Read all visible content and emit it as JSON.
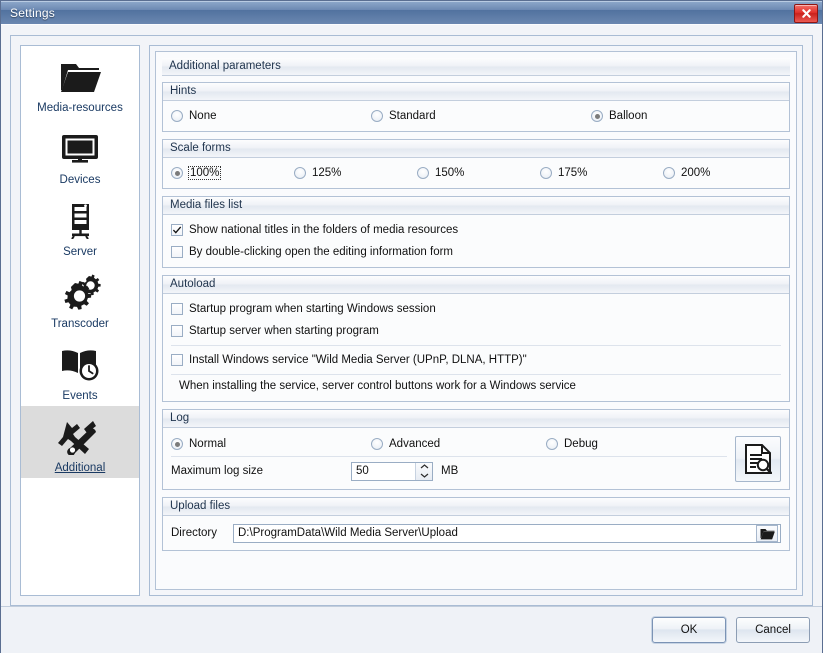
{
  "window": {
    "title": "Settings",
    "close_icon": "close-icon"
  },
  "sidebar": {
    "items": [
      {
        "label": "Media-resources",
        "icon": "folder-icon",
        "selected": false
      },
      {
        "label": "Devices",
        "icon": "monitor-icon",
        "selected": false
      },
      {
        "label": "Server",
        "icon": "server-rack-icon",
        "selected": false
      },
      {
        "label": "Transcoder",
        "icon": "gears-icon",
        "selected": false
      },
      {
        "label": "Events",
        "icon": "book-clock-icon",
        "selected": false
      },
      {
        "label": "Additional",
        "icon": "tools-icon",
        "selected": true
      }
    ]
  },
  "main": {
    "title": "Additional parameters",
    "groups": {
      "hints": {
        "header": "Hints",
        "options": [
          {
            "label": "None",
            "selected": false
          },
          {
            "label": "Standard",
            "selected": false
          },
          {
            "label": "Balloon",
            "selected": true
          }
        ]
      },
      "scale_forms": {
        "header": "Scale forms",
        "options": [
          {
            "label": "100%",
            "selected": true,
            "focused": true
          },
          {
            "label": "125%",
            "selected": false,
            "focused": false
          },
          {
            "label": "150%",
            "selected": false,
            "focused": false
          },
          {
            "label": "175%",
            "selected": false,
            "focused": false
          },
          {
            "label": "200%",
            "selected": false,
            "focused": false
          }
        ]
      },
      "media_files_list": {
        "header": "Media files list",
        "checkboxes": [
          {
            "label": "Show national titles in the folders of media resources",
            "checked": true
          },
          {
            "label": "By double-clicking open the editing information form",
            "checked": false
          }
        ]
      },
      "autoload": {
        "header": "Autoload",
        "checkboxes": [
          {
            "label": "Startup program when starting Windows session",
            "checked": false
          },
          {
            "label": "Startup server when starting program",
            "checked": false
          },
          {
            "label": "Install Windows service \"Wild Media Server (UPnP, DLNA, HTTP)\"",
            "checked": false
          }
        ],
        "note": "When installing the service, server control buttons work for a Windows service"
      },
      "log": {
        "header": "Log",
        "options": [
          {
            "label": "Normal",
            "selected": true
          },
          {
            "label": "Advanced",
            "selected": false
          },
          {
            "label": "Debug",
            "selected": false
          }
        ],
        "max_size_label": "Maximum log size",
        "max_size_value": "50",
        "max_size_unit": "MB",
        "view_log_icon": "document-search-icon"
      },
      "upload_files": {
        "header": "Upload files",
        "directory_label": "Directory",
        "directory_value": "D:\\ProgramData\\Wild Media Server\\Upload",
        "browse_icon": "folder-open-icon"
      }
    }
  },
  "footer": {
    "ok_label": "OK",
    "cancel_label": "Cancel"
  }
}
